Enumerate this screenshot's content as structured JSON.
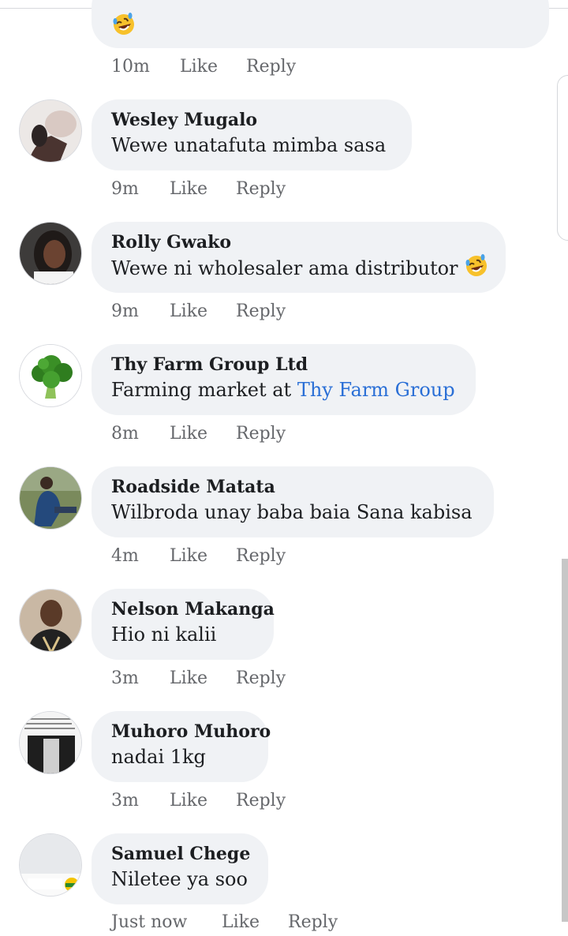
{
  "actions": {
    "like_label": "Like",
    "reply_label": "Reply"
  },
  "first": {
    "time": "10m"
  },
  "comments": [
    {
      "name": "Wesley Mugalo",
      "text": "Wewe unatafuta mimba sasa",
      "time": "9m"
    },
    {
      "name": "Rolly Gwako",
      "text": "Wewe ni wholesaler ama distributor",
      "time": "9m"
    },
    {
      "name": "Thy Farm Group Ltd",
      "text": "Farming market at ",
      "link": "Thy Farm Group",
      "time": "8m"
    },
    {
      "name": "Roadside Matata",
      "text": "Wilbroda unay baba baia Sana kabisa",
      "time": "4m"
    },
    {
      "name": "Nelson Makanga",
      "text": "Hio ni kalii",
      "time": "3m"
    },
    {
      "name": "Muhoro Muhoro",
      "text": "nadai 1kg",
      "time": "3m"
    },
    {
      "name": "Samuel Chege",
      "text": "Niletee ya soo",
      "time": "Just now"
    }
  ],
  "icons": {
    "laugh": "rofl-emoji-icon"
  },
  "colors": {
    "bubble": "#f0f2f5",
    "link": "#2a6fd6",
    "meta": "#65676b"
  }
}
